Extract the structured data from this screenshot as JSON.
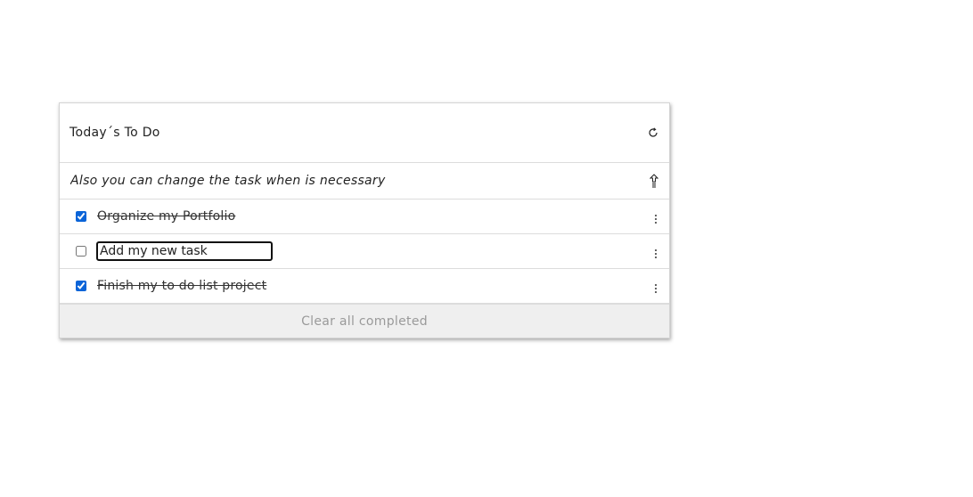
{
  "header": {
    "title": "Today´s To Do",
    "refresh_icon": "refresh-icon"
  },
  "add_task": {
    "placeholder": "Also you can change the task when is necessary",
    "enter_icon": "enter-icon"
  },
  "tasks": [
    {
      "text": "Organize my Portfolio",
      "completed": true
    },
    {
      "text": "Add my new task",
      "completed": false,
      "editing": true
    },
    {
      "text": "Finish my to do list project",
      "completed": true
    }
  ],
  "footer": {
    "clear_label": "Clear all completed"
  },
  "colors": {
    "accent": "#0a64d8",
    "footer_bg": "#efefef",
    "footer_text": "#9a9a9a"
  }
}
